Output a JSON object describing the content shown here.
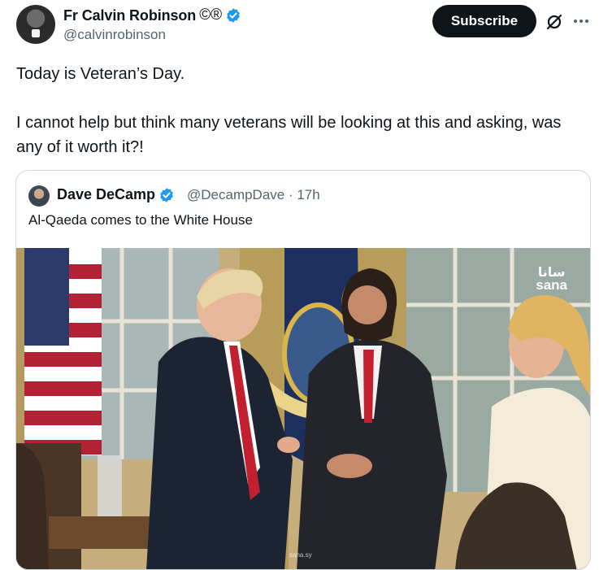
{
  "author": {
    "name": "Fr Calvin Robinson",
    "marks": "©®",
    "handle": "@calvinrobinson"
  },
  "actions": {
    "subscribe_label": "Subscribe"
  },
  "tweet": {
    "line1": "Today is Veteran’s Day.",
    "line2": "I cannot help but think many veterans will be looking at this and asking, was any of it worth it?!"
  },
  "quote": {
    "name": "Dave DeCamp",
    "handle_time": "@DecampDave · 17h",
    "text": "Al-Qaeda comes to the White House",
    "photo": {
      "watermark_ar": "سانا",
      "watermark": "sana",
      "credit": "sana.sy"
    }
  },
  "colors": {
    "verified": "#1d9bf0",
    "subscribe_bg": "#0f1419",
    "secondary_text": "#536471"
  },
  "icons": [
    "verified-badge-icon",
    "grok-icon",
    "more-options-icon"
  ]
}
